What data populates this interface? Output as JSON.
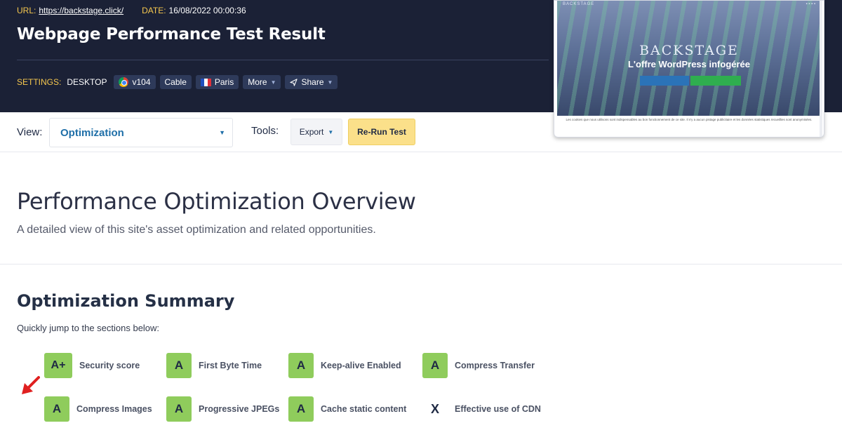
{
  "header": {
    "url_label": "URL:",
    "url": "https://backstage.click/",
    "date_label": "DATE:",
    "date": "16/08/2022 00:00:36",
    "title": "Webpage Performance Test Result",
    "settings_label": "SETTINGS:",
    "device": "DESKTOP",
    "browser_version": "v104",
    "connection": "Cable",
    "location": "Paris",
    "more": "More",
    "share": "Share"
  },
  "thumbnail": {
    "brand": "BACKSTAGE",
    "big_text": "BACKSTAGE",
    "subtitle": "L'offre WordPress infogérée",
    "cookie_text": "Les cookies que nous utilisons sont indispensables au bon fonctionnement de ce site. Il n'y a aucun pistage publicitaire et les données statistiques recueillies sont anonymisées."
  },
  "toolbar": {
    "view_label": "View:",
    "view_value": "Optimization",
    "tools_label": "Tools:",
    "export": "Export",
    "rerun": "Re-Run Test"
  },
  "overview": {
    "title": "Performance Optimization Overview",
    "description": "A detailed view of this site's asset optimization and related opportunities."
  },
  "summary": {
    "title": "Optimization Summary",
    "subtitle": "Quickly jump to the sections below:",
    "items": [
      {
        "grade": "A+",
        "label": "Security score"
      },
      {
        "grade": "A",
        "label": "First Byte Time"
      },
      {
        "grade": "A",
        "label": "Keep-alive Enabled"
      },
      {
        "grade": "A",
        "label": "Compress Transfer"
      },
      {
        "grade": "A",
        "label": "Compress Images"
      },
      {
        "grade": "A",
        "label": "Progressive JPEGs"
      },
      {
        "grade": "A",
        "label": "Cache static content"
      },
      {
        "grade": "X",
        "label": "Effective use of CDN"
      }
    ]
  },
  "colors": {
    "header_bg": "#1b2136",
    "accent_yellow": "#f5c74e",
    "grade_green": "#8fcc5c",
    "link_blue": "#1f6fa8",
    "rerun_bg": "#fbe08a",
    "arrow_red": "#e02020"
  }
}
